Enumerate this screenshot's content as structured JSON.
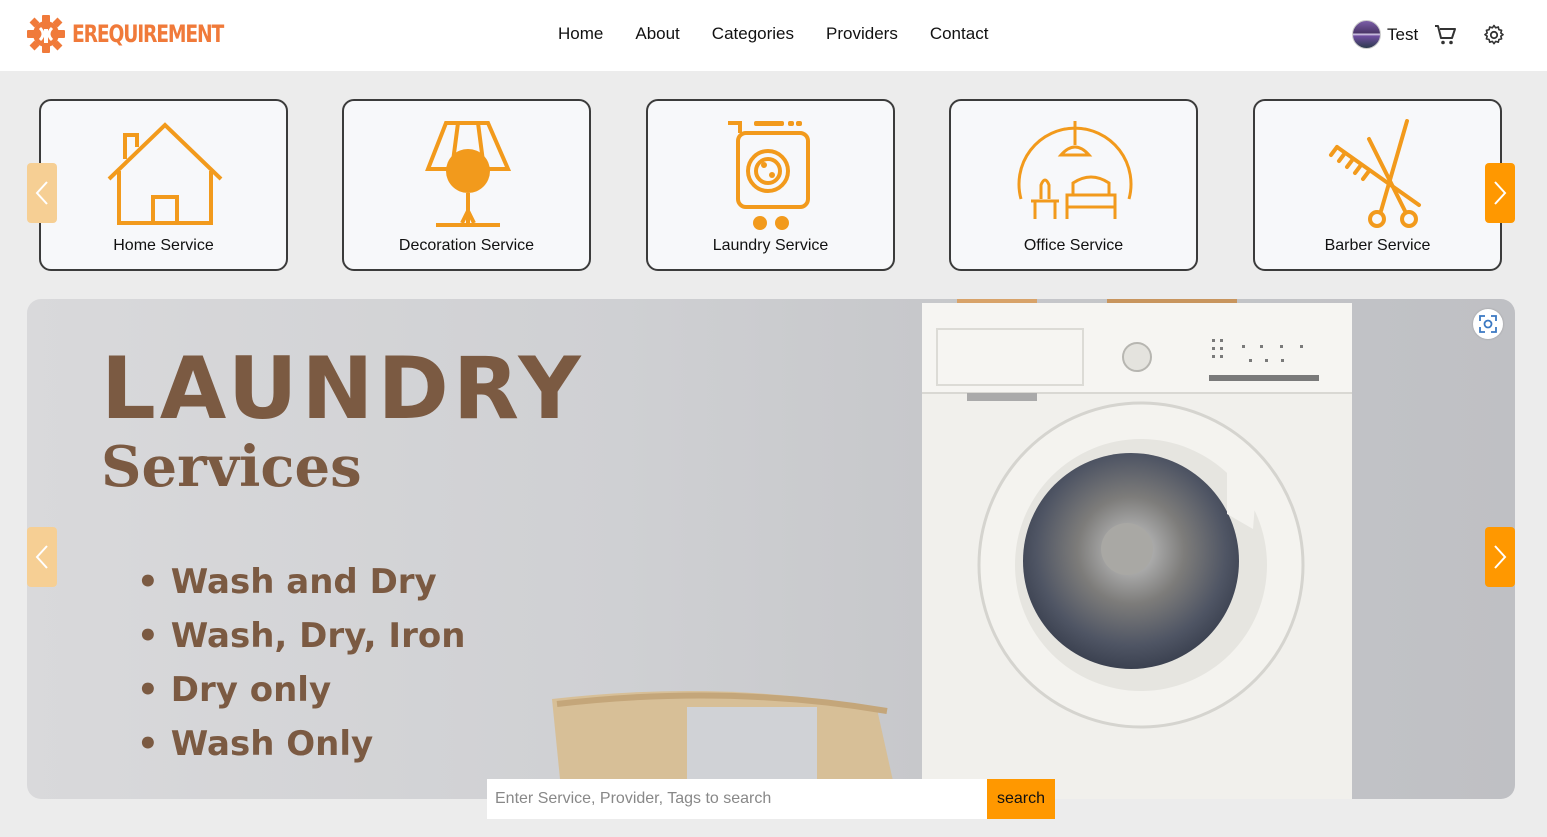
{
  "header": {
    "logo_text": "EREQUIREMENT",
    "nav": [
      "Home",
      "About",
      "Categories",
      "Providers",
      "Contact"
    ],
    "user_name": "Test"
  },
  "categories": [
    {
      "label": "Home Service",
      "icon": "house-icon"
    },
    {
      "label": "Decoration Service",
      "icon": "lamp-icon"
    },
    {
      "label": "Laundry Service",
      "icon": "laundry-cart-icon"
    },
    {
      "label": "Office Service",
      "icon": "office-lounge-icon"
    },
    {
      "label": "Barber Service",
      "icon": "comb-scissors-icon"
    }
  ],
  "banner": {
    "title": "LAUNDRY",
    "subtitle": "Services",
    "items": [
      "Wash and Dry",
      "Wash, Dry, Iron",
      "Dry only",
      "Wash Only"
    ]
  },
  "search": {
    "placeholder": "Enter Service, Provider, Tags to search",
    "button_label": "search"
  },
  "colors": {
    "accent": "#ff9800",
    "accent_light": "#f6cf94",
    "logo": "#f07a3a",
    "banner_text": "#7b5a42"
  }
}
